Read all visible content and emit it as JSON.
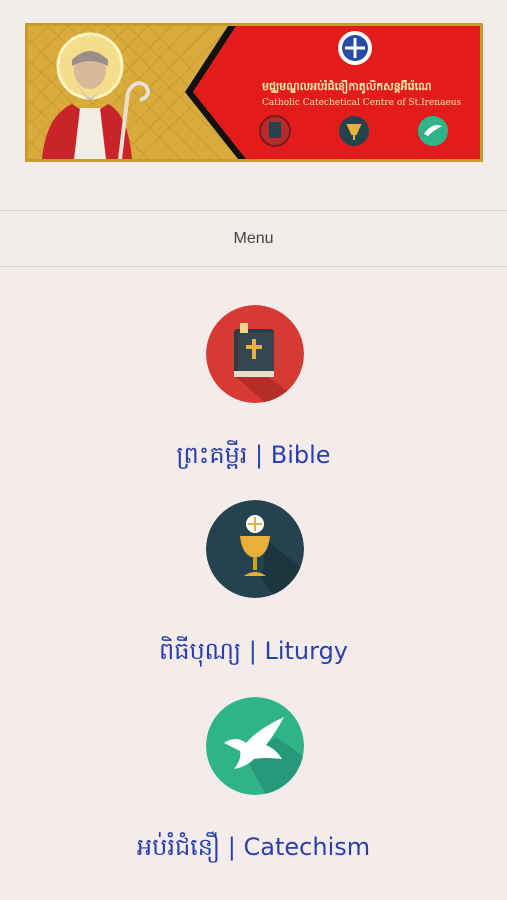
{
  "header": {
    "title_kh": "មជ្ឈមណ្ឌលអប់រំជំនឿកាតូលិកសន្តអ៊ីរ៉េណេ",
    "title_en": "Catholic Catechetical Centre of St.Irenaeus"
  },
  "menu": {
    "label": "Menu"
  },
  "items": [
    {
      "label": "ព្រះគម្ពីរ | Bible",
      "icon": "bible-icon",
      "color": "#d63b33"
    },
    {
      "label": "ពិធីបុណ្យ | Liturgy",
      "icon": "chalice-icon",
      "color": "#24434f"
    },
    {
      "label": "អប់រំជំនឿ | Catechism",
      "icon": "dove-icon",
      "color": "#2fb489"
    }
  ],
  "colors": {
    "accent": "#2b3fb0",
    "banner_red": "#e01c1c",
    "banner_gold": "#d8a93a"
  }
}
